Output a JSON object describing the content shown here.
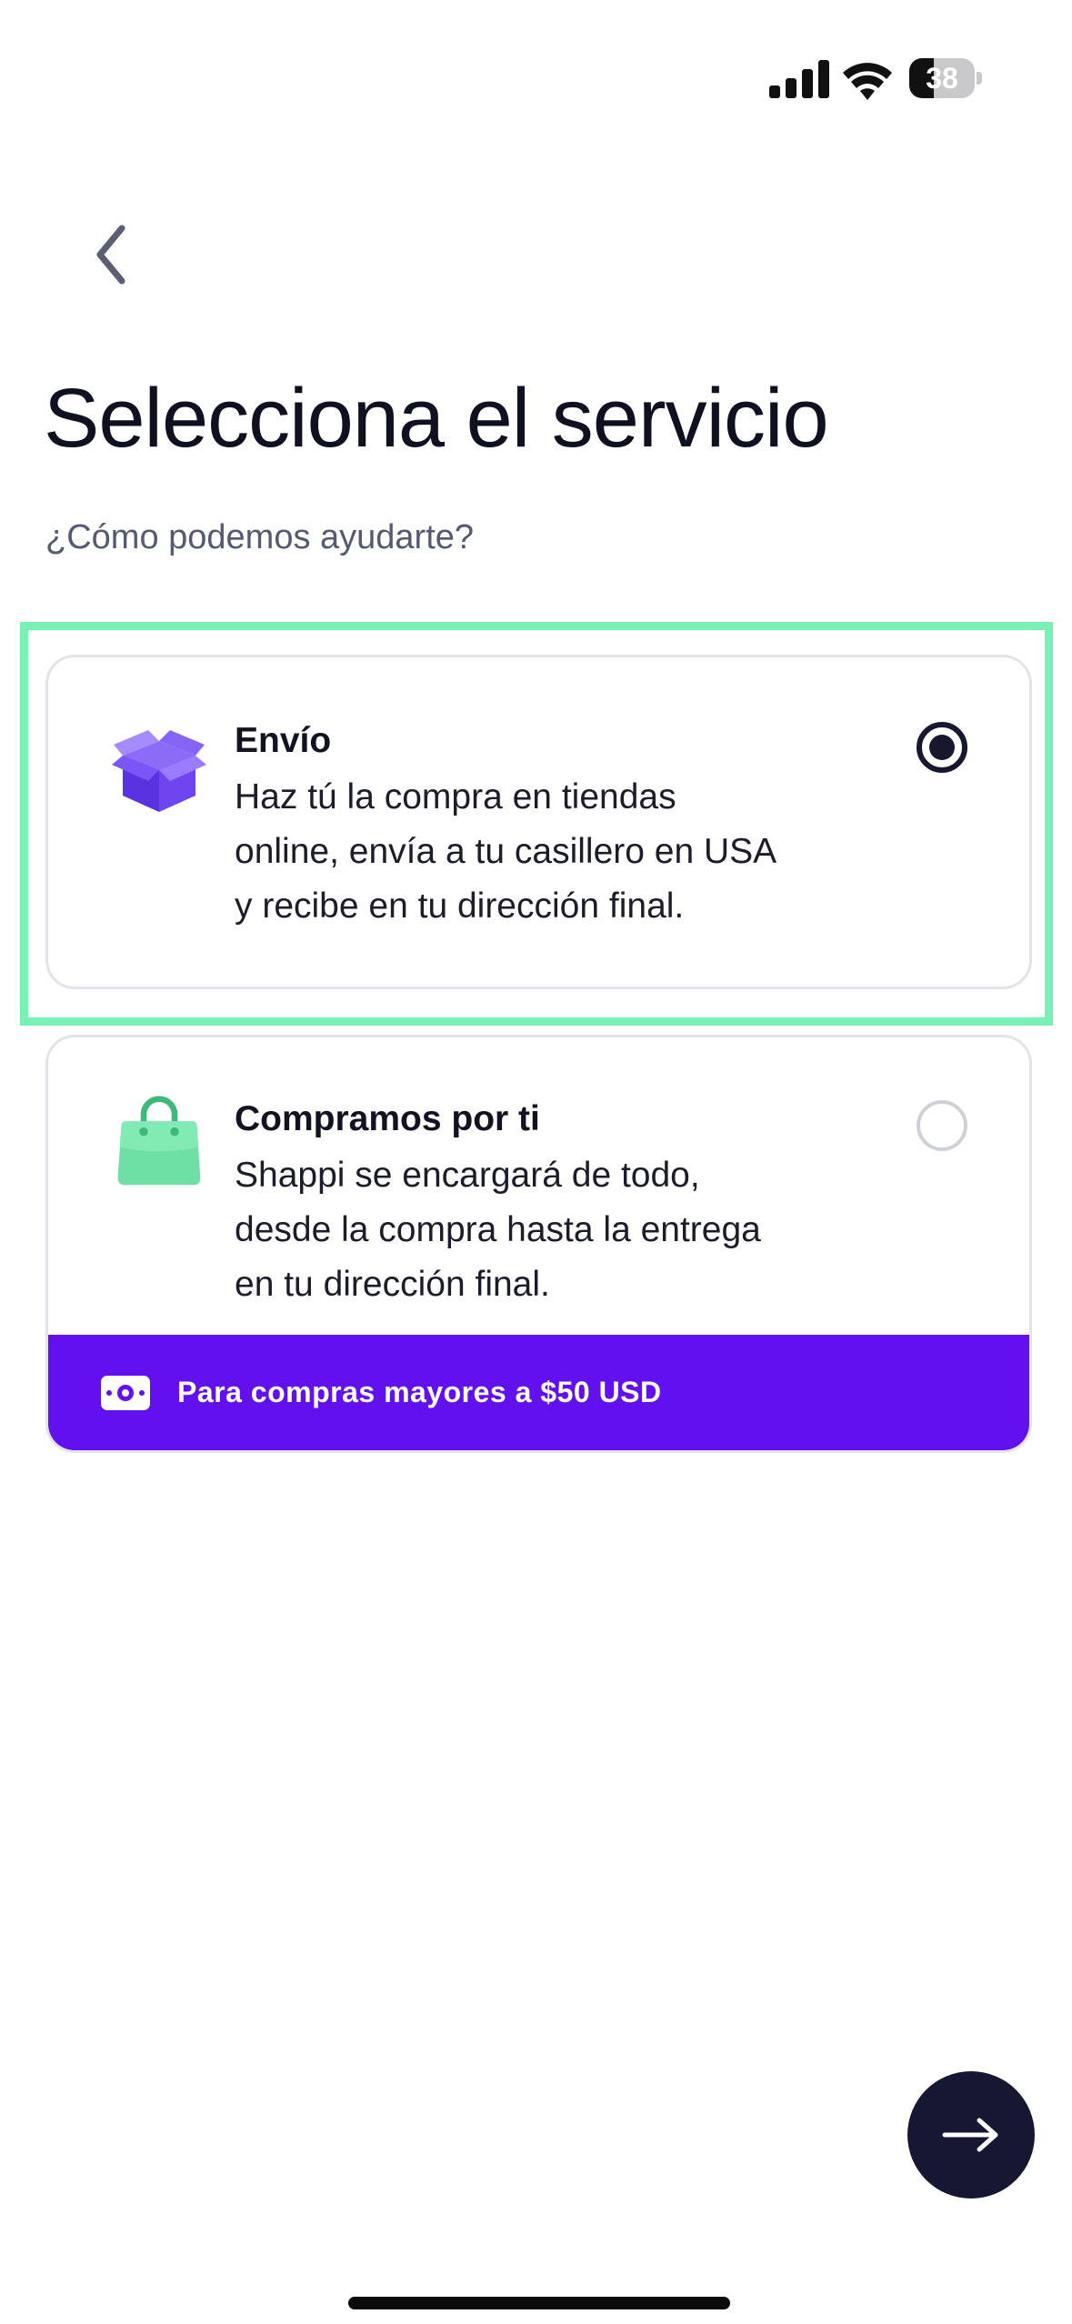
{
  "status_bar": {
    "battery_level": "38",
    "battery_fraction": 0.38,
    "icons": [
      "signal-icon",
      "wifi-icon",
      "battery-icon"
    ]
  },
  "header": {
    "back_icon": "chevron-left-icon",
    "title": "Selecciona el servicio",
    "subtitle": "¿Cómo podemos ayudarte?"
  },
  "services": [
    {
      "id": "envio",
      "icon": "box-icon",
      "title": "Envío",
      "description_lines": [
        "Haz tú la compra en tiendas",
        "online, envía a tu casillero en USA",
        "y recibe en tu dirección final."
      ],
      "selected": true
    },
    {
      "id": "compramos",
      "icon": "shopping-bag-icon",
      "title": "Compramos por ti",
      "description_lines": [
        "Shappi se encargará de todo,",
        "desde la compra hasta la entrega",
        "en tu dirección final."
      ],
      "selected": false,
      "banner": {
        "icon": "cash-icon",
        "text": "Para compras mayores a $50 USD"
      }
    }
  ],
  "actions": {
    "next_icon": "arrow-right-icon"
  },
  "colors": {
    "highlight": "#78f1b4",
    "banner": "#6210ee",
    "button": "#161733",
    "box_icon": "#6a3df0",
    "bag_icon": "#5fd89a"
  }
}
